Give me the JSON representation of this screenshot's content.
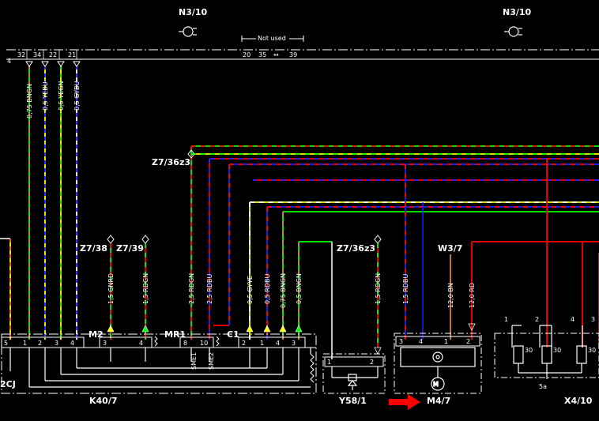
{
  "header": {
    "n3_left": "N3/10",
    "n3_right": "N3/10",
    "not_used": "Not used",
    "top_pins": [
      "32",
      "34",
      "22",
      "21"
    ],
    "left_num": "4",
    "pin_20": "20",
    "pin_35": "35",
    "pin_39": "39"
  },
  "wires": {
    "w1": "0,75 BNGN",
    "w2": "0,5 YEBU",
    "w3": "0,5 YEGN",
    "w4": "0,5 GYBU",
    "w5": "1,5 GNRD",
    "w6": "1,5 RDGN",
    "w7": "2,5 RDGN",
    "w8": "2,5 RDBU",
    "w9": "0,5 GYYE",
    "w10": "0,5 RDBU",
    "w11": "0,75 BNGN",
    "w12": "0,5 BNGN",
    "w13": "1,5 RDGN",
    "w14": "1,5 RDBU",
    "w15": "12,0 BN",
    "w16": "12,0 RD"
  },
  "connectors": {
    "z7_36z3_a": "Z7/36z3",
    "z7_38": "Z7/38",
    "z7_39": "Z7/39",
    "z7_36z3_b": "Z7/36z3",
    "w3_7": "W3/7"
  },
  "components": {
    "k40": "K40/7",
    "y58": "Y58/1",
    "m4": "M4/7",
    "x4": "X4/10",
    "cj": "2CJ",
    "m2": "M2",
    "mr1": "MR1",
    "c1": "C1",
    "sme1": "SME1",
    "sme2": "SME2",
    "x4_5a": "5a",
    "x4_pins": [
      "1",
      "2",
      "4",
      "3"
    ],
    "fuse_30": "30"
  },
  "pins": {
    "k40_group1": [
      "5",
      "1",
      "2",
      "3",
      "4"
    ],
    "k40_group2": [
      "3",
      "4"
    ],
    "k40_group3": [
      "8",
      "10"
    ],
    "k40_group4": [
      "2",
      "1",
      "4",
      "3"
    ],
    "y58": [
      "1",
      "2"
    ],
    "m4": [
      "3",
      "4",
      "1",
      "2"
    ]
  },
  "colors": {
    "green": "#00ff00",
    "yellow": "#ffff00",
    "blue": "#2020ff",
    "red": "#ff0000",
    "brown": "#d08040",
    "white": "#ffffff",
    "arrow": "#ff0000"
  }
}
